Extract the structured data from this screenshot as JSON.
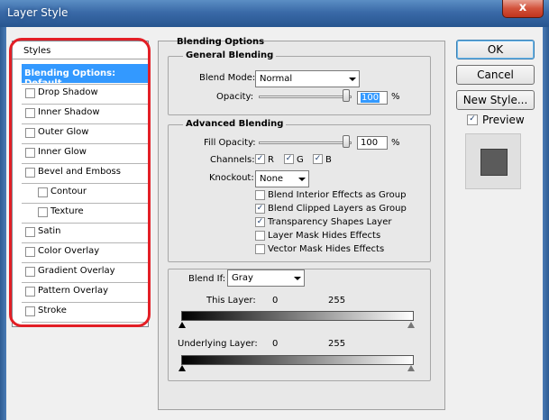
{
  "window": {
    "title": "Layer Style",
    "close_glyph": "x"
  },
  "styles_panel": {
    "header": "Styles",
    "items": [
      {
        "label": "Blending Options: Default",
        "selected": true,
        "has_checkbox": false
      },
      {
        "label": "Drop Shadow",
        "checked": false
      },
      {
        "label": "Inner Shadow",
        "checked": false
      },
      {
        "label": "Outer Glow",
        "checked": false
      },
      {
        "label": "Inner Glow",
        "checked": false
      },
      {
        "label": "Bevel and Emboss",
        "checked": false
      },
      {
        "label": "Contour",
        "checked": false
      },
      {
        "label": "Texture",
        "checked": false
      },
      {
        "label": "Satin",
        "checked": false
      },
      {
        "label": "Color Overlay",
        "checked": false
      },
      {
        "label": "Gradient Overlay",
        "checked": false
      },
      {
        "label": "Pattern Overlay",
        "checked": false
      },
      {
        "label": "Stroke",
        "checked": false
      }
    ],
    "highlight_color": "#e31f26"
  },
  "blending_options": {
    "title": "Blending Options",
    "general": {
      "title": "General Blending",
      "blend_mode_label": "Blend Mode:",
      "blend_mode_value": "Normal",
      "opacity_label": "Opacity:",
      "opacity_value": "100",
      "opacity_unit": "%"
    },
    "advanced": {
      "title": "Advanced Blending",
      "fill_opacity_label": "Fill Opacity:",
      "fill_opacity_value": "100",
      "fill_opacity_unit": "%",
      "channels_label": "Channels:",
      "channels": [
        {
          "label": "R",
          "checked": true
        },
        {
          "label": "G",
          "checked": true
        },
        {
          "label": "B",
          "checked": true
        }
      ],
      "knockout_label": "Knockout:",
      "knockout_value": "None",
      "options": [
        {
          "label": "Blend Interior Effects as Group",
          "checked": false
        },
        {
          "label": "Blend Clipped Layers as Group",
          "checked": true
        },
        {
          "label": "Transparency Shapes Layer",
          "checked": true
        },
        {
          "label": "Layer Mask Hides Effects",
          "checked": false
        },
        {
          "label": "Vector Mask Hides Effects",
          "checked": false
        }
      ]
    },
    "blend_if": {
      "label": "Blend If:",
      "value": "Gray",
      "this_layer_label": "This Layer:",
      "this_layer_min": "0",
      "this_layer_max": "255",
      "underlying_label": "Underlying Layer:",
      "underlying_min": "0",
      "underlying_max": "255"
    }
  },
  "buttons": {
    "ok": "OK",
    "cancel": "Cancel",
    "new_style": "New Style...",
    "preview_label": "Preview",
    "preview_checked": true
  },
  "icons": {
    "checkmark": "✓",
    "close": "close-icon",
    "dropdown": "chevron-down-icon"
  },
  "colors": {
    "selection": "#3399ff",
    "title_bar": "#3a6aa8",
    "close_button": "#c1341c"
  }
}
